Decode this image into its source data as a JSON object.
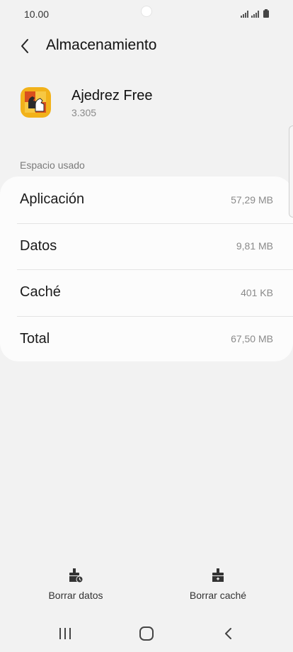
{
  "status_bar": {
    "time": "10.00"
  },
  "header": {
    "title": "Almacenamiento"
  },
  "app": {
    "name": "Ajedrez Free",
    "version": "3.305"
  },
  "section_label": "Espacio usado",
  "storage_rows": [
    {
      "label": "Aplicación",
      "value": "57,29 MB"
    },
    {
      "label": "Datos",
      "value": "9,81 MB"
    },
    {
      "label": "Caché",
      "value": "401 KB"
    },
    {
      "label": "Total",
      "value": "67,50 MB"
    }
  ],
  "actions": {
    "clear_data_label": "Borrar datos",
    "clear_cache_label": "Borrar caché"
  },
  "icons": {
    "back": "chevron-left-icon",
    "clear_data": "broom-clock-icon",
    "clear_cache": "broom-icon",
    "nav_recents": "recents-icon",
    "nav_home": "home-icon",
    "nav_back": "back-icon"
  }
}
